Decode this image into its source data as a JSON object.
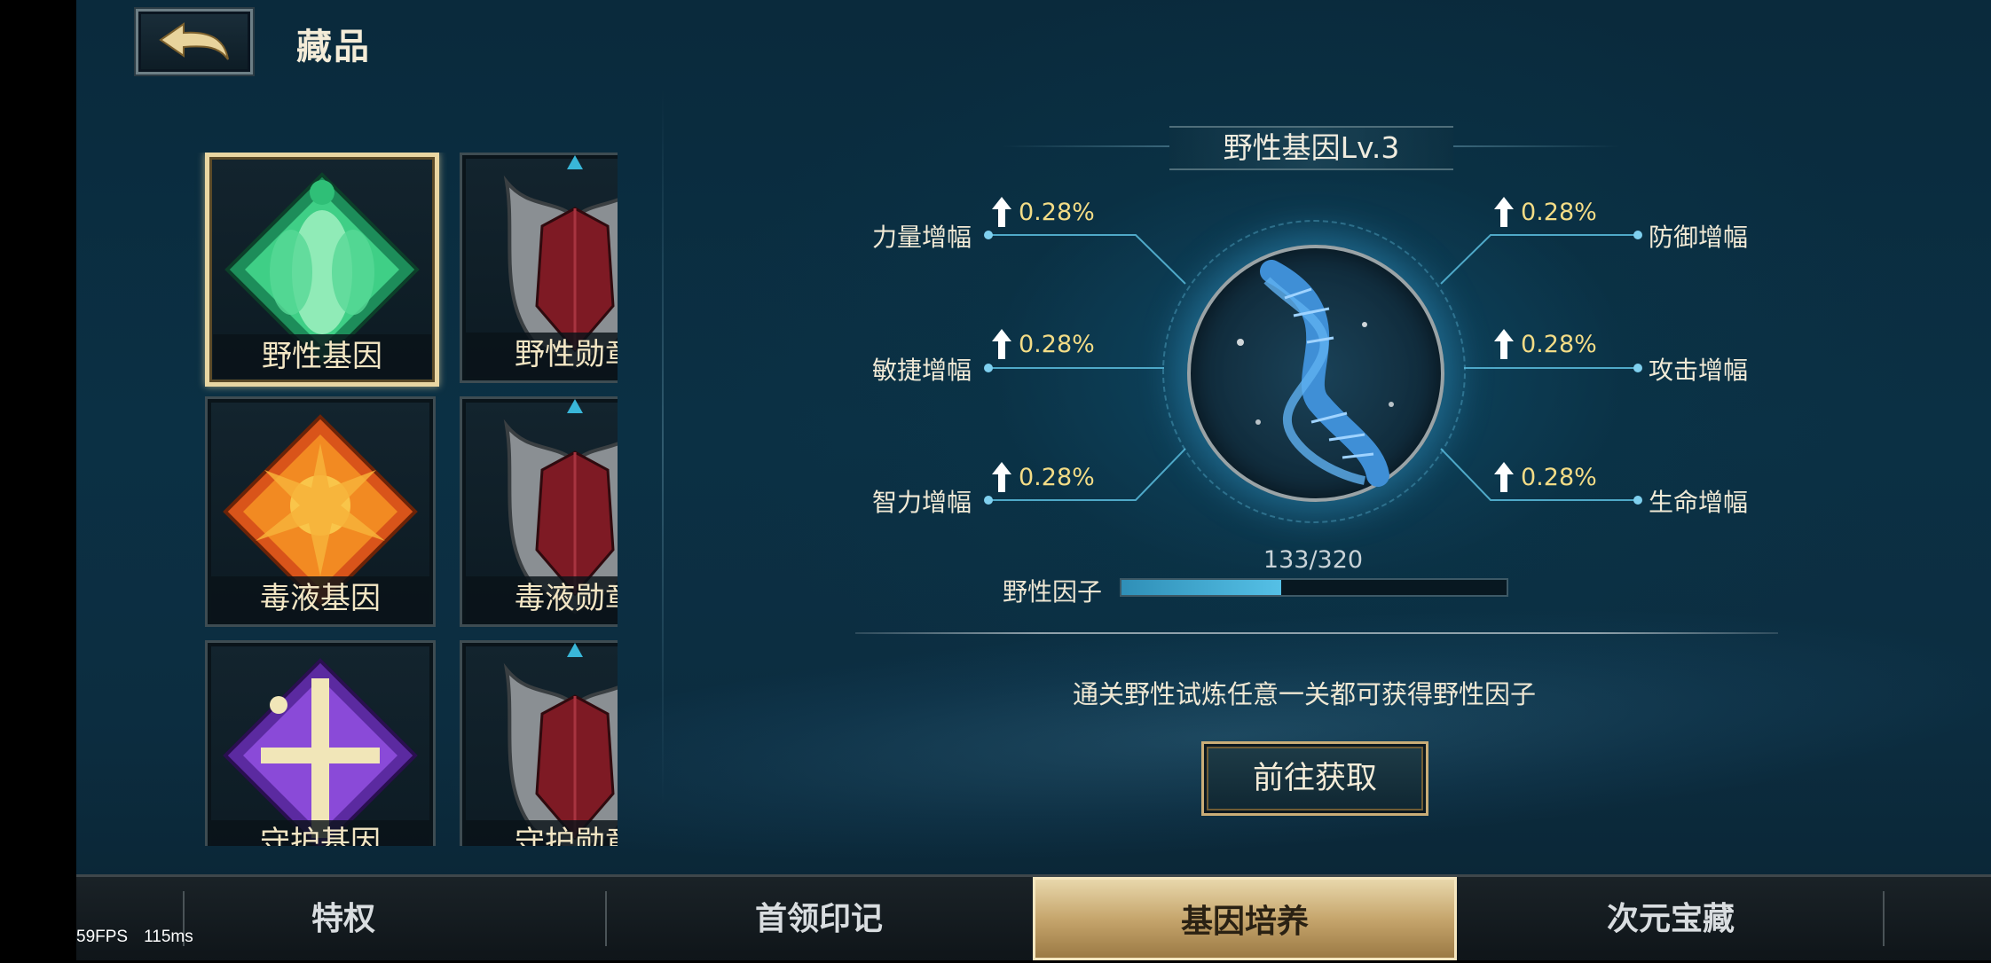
{
  "header": {
    "title": "藏品"
  },
  "items": [
    {
      "label": "野性基因",
      "kind": "gene",
      "color": "#2fbf77",
      "selected": true
    },
    {
      "label": "野性勋章",
      "kind": "medal",
      "color": "#8b1b28",
      "selected": false
    },
    {
      "label": "毒液基因",
      "kind": "gene",
      "color": "#e86a1a",
      "selected": false
    },
    {
      "label": "毒液勋章",
      "kind": "medal",
      "color": "#8b1b28",
      "selected": false
    },
    {
      "label": "守护基因",
      "kind": "gene",
      "color": "#7a3cc2",
      "selected": false
    },
    {
      "label": "守护勋章",
      "kind": "medal",
      "color": "#8b1b28",
      "selected": false
    }
  ],
  "detail": {
    "title": "野性基因Lv.3",
    "stats_left": [
      {
        "label": "力量增幅",
        "value": "0.28%"
      },
      {
        "label": "敏捷增幅",
        "value": "0.28%"
      },
      {
        "label": "智力增幅",
        "value": "0.28%"
      }
    ],
    "stats_right": [
      {
        "label": "防御增幅",
        "value": "0.28%"
      },
      {
        "label": "攻击增幅",
        "value": "0.28%"
      },
      {
        "label": "生命增幅",
        "value": "0.28%"
      }
    ],
    "progress": {
      "label": "野性因子",
      "current": 133,
      "max": 320,
      "text": "133/320"
    },
    "hint": "通关野性试炼任意一关都可获得野性因子",
    "go_button": "前往获取"
  },
  "tabs": [
    {
      "label": "特权",
      "active": false
    },
    {
      "label": "首领印记",
      "active": false
    },
    {
      "label": "基因培养",
      "active": true
    },
    {
      "label": "次元宝藏",
      "active": false
    }
  ],
  "debug": {
    "fps": "59FPS",
    "latency": "115ms"
  },
  "colors": {
    "accent_gold": "#e9d6a2",
    "value_yellow": "#f3dc86",
    "bg": "#0b3044"
  }
}
